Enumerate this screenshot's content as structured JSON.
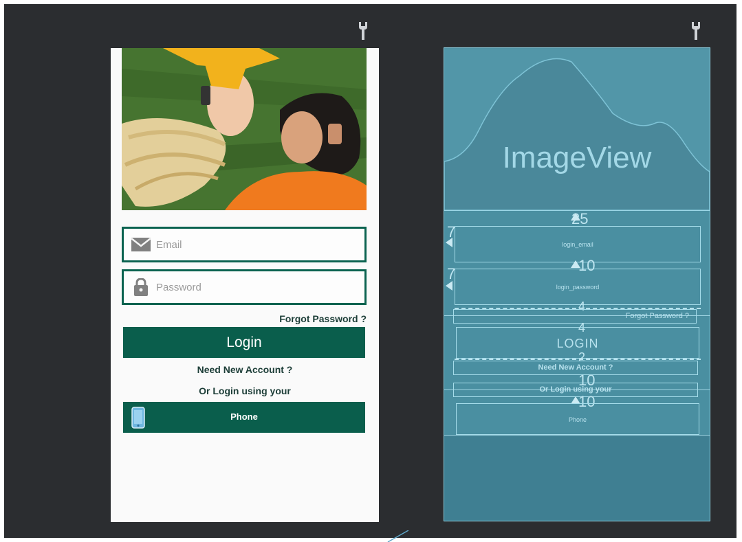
{
  "design_view": {
    "email_placeholder": "Email",
    "password_placeholder": "Password",
    "forgot_password": "Forgot Password ?",
    "login_button": "Login",
    "need_new_account": "Need New Account ?",
    "or_login_using": "Or Login using your",
    "phone_button": "Phone"
  },
  "blueprint_view": {
    "image_label": "ImageView",
    "email_id": "login_email",
    "password_id": "login_password",
    "forgot_password": "Forgot Password ?",
    "login_button": "LOGIN",
    "need_new_account": "Need New Account ?",
    "or_login_using": "Or Login using your",
    "phone_button": "Phone",
    "margins": {
      "top": "25",
      "email_left": "7",
      "password_top": "10",
      "password_left": "7",
      "forgot_top": "4",
      "login_top": "4",
      "account_top": "2",
      "or_top": "10",
      "phone_top": "10"
    }
  },
  "icons": [
    "wrench-icon",
    "envelope-icon",
    "lock-icon",
    "phone-icon"
  ],
  "colors": {
    "canvas": "#2b2d30",
    "accent": "#0a5e4c",
    "blueprint": "#4a8fa1"
  }
}
